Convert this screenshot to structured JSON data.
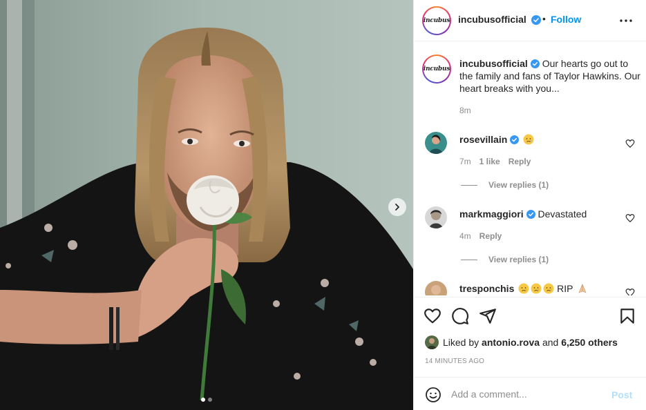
{
  "post": {
    "author": "incubusofficial",
    "logo_text": "incubus",
    "follow_label": "Follow",
    "bullet": "•",
    "caption": "Our hearts go out to the family and fans of Taylor Hawkins. Our heart breaks with you...",
    "caption_time": "8m"
  },
  "comments": [
    {
      "username": "rosevillain",
      "verified": true,
      "text": "",
      "emojis": [
        "crying-face"
      ],
      "time": "7m",
      "likes": "1 like",
      "reply_label": "Reply",
      "view_replies": "View replies (1)"
    },
    {
      "username": "markmaggiori",
      "verified": true,
      "text": "Devastated",
      "emojis": [],
      "time": "4m",
      "likes": "",
      "reply_label": "Reply",
      "view_replies": "View replies (1)"
    },
    {
      "username": "tresponchis",
      "verified": false,
      "text": "RIP",
      "emojis": [
        "crying-face",
        "crying-face",
        "crying-face",
        "folded-hands"
      ]
    }
  ],
  "engagement": {
    "liked_by_prefix": "Liked by",
    "liked_by_user": "antonio.rova",
    "and": "and",
    "others": "6,250 others",
    "time_ago": "14 MINUTES AGO"
  },
  "composer": {
    "placeholder": "Add a comment...",
    "post_label": "Post"
  },
  "carousel": {
    "slides": 2,
    "active_index": 0
  },
  "icons": [
    "more-icon",
    "verified-icon",
    "heart-icon",
    "comment-icon",
    "share-icon",
    "bookmark-icon",
    "emoji-icon",
    "chevron-right-icon"
  ],
  "colors": {
    "accent": "#0095f6",
    "verified": "#3897f0",
    "muted": "#8e8e8e",
    "text": "#262626",
    "post_disabled": "#b2dffc"
  }
}
